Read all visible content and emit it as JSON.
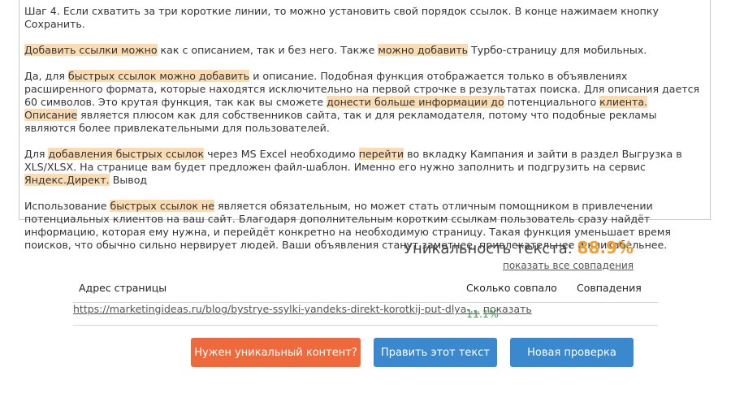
{
  "text": {
    "p1": [
      "Шаг 4. Если схватить за три короткие линии, то можно установить свой порядок ссылок. В конце нажимаем кнопку Сохранить."
    ],
    "p2": [
      "Добавить ссылки можно",
      " как с описанием, так и без него. Также ",
      "можно добавить",
      " Турбо-страницу для мобильных."
    ],
    "p3": [
      "Да, для ",
      "быстрых ссылок можно добавить",
      " и описание. Подобная функция отображается только в объявлениях расширенного формата, которые находятся исключительно на первой строчке в результатах поиска. Для описания дается 60 символов. Это крутая функция, так как вы сможете ",
      "донести больше информации до",
      " потенциального ",
      "клиента. Описание",
      " является плюсом как для собственников сайта, так и для рекламодателя, потому что подобные рекламы являются более привлекательными для пользователей."
    ],
    "p4": [
      "Для ",
      "добавления быстрых ссылок",
      " через MS Excel необходимо ",
      "перейти",
      " во вкладку Кампания и зайти в раздел Выгрузка в XLS/XLSX. На странице вам будет предложен файл-шаблон. Именно его нужно заполнить и подгрузить на сервис ",
      "Яндекс.Директ.",
      " Вывод"
    ],
    "p5": [
      "Использование ",
      "быстрых ссылок не",
      " является обязательным, но может стать отличным помощником в привлечении потенциальных клиентов на ваш сайт. Благодаря дополнительным коротким ссылкам пользователь сразу найдёт информацию, которая ему нужна, и перейдёт конкретно на необходимую страницу. Такая функция уменьшает время поисков, что обычно сильно нервирует людей. Ваши объявления станут заметнее, привлекательнее и кликабельнее."
    ]
  },
  "uniqueness": {
    "label": "Уникальность текста:",
    "value": "88.9%",
    "show_all": "показать все совпадения"
  },
  "table": {
    "headers": [
      "Адрес страницы",
      "Сколько совпало",
      "Совпадения"
    ],
    "rows": [
      {
        "url": "https://marketingideas.ru/blog/bystrye-ssylki-yandeks-direkt-korotkij-put-dlya-...",
        "pct": "11.1%",
        "action": "показать"
      }
    ]
  },
  "buttons": {
    "unique_content": "Нужен уникальный контент?",
    "edit_text": "Править этот текст",
    "new_check": "Новая проверка"
  },
  "colors": {
    "highlight": "#fbdcb2",
    "uniq_value": "#f0a032",
    "match_pct": "#3aa050",
    "orange_button": "#ee6a3d",
    "blue_button": "#3a88ce"
  }
}
